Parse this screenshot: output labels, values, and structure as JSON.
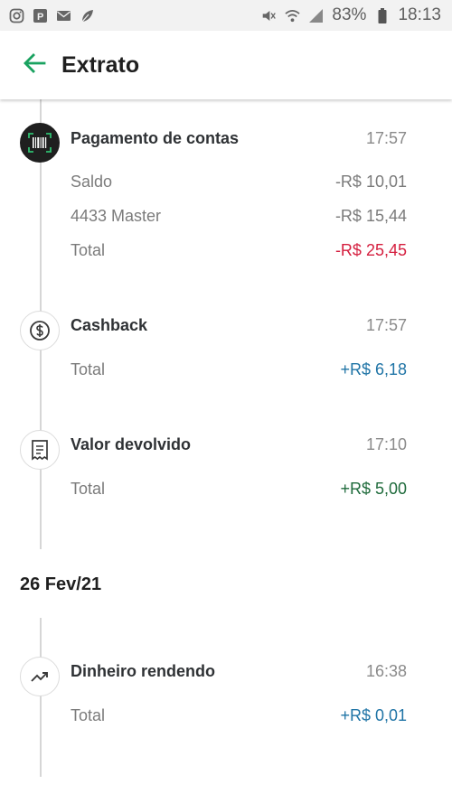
{
  "status_bar": {
    "battery": "83%",
    "time": "18:13",
    "left_icons": [
      "instagram-icon",
      "parking-icon",
      "mail-icon",
      "leaf-icon"
    ],
    "right_icons": [
      "mute-icon",
      "wifi-icon",
      "signal-icon",
      "battery-icon"
    ]
  },
  "app_bar": {
    "title": "Extrato",
    "back_icon": "arrow-left-icon",
    "accent": "#1aa260"
  },
  "timeline": [
    {
      "icon": "barcode-icon",
      "title": "Pagamento de contas",
      "time": "17:57",
      "rows": [
        {
          "label": "Saldo",
          "value": "-R$ 10,01",
          "color": "#7b7b7b"
        },
        {
          "label": "4433 Master",
          "value": "-R$ 15,44",
          "color": "#7b7b7b"
        },
        {
          "label": "Total",
          "value": "-R$ 25,45",
          "color": "#d51f3f"
        }
      ]
    },
    {
      "icon": "dollar-coin-icon",
      "title": "Cashback",
      "time": "17:57",
      "rows": [
        {
          "label": "Total",
          "value": "+R$ 6,18",
          "color": "#1f74a6"
        }
      ]
    },
    {
      "icon": "receipt-icon",
      "title": "Valor devolvido",
      "time": "17:10",
      "rows": [
        {
          "label": "Total",
          "value": "+R$ 5,00",
          "color": "#1f6b3c"
        }
      ]
    }
  ],
  "date_heading": "26 Fev/21",
  "timeline_2": [
    {
      "icon": "trending-up-icon",
      "title": "Dinheiro rendendo",
      "time": "16:38",
      "rows": [
        {
          "label": "Total",
          "value": "+R$ 0,01",
          "color": "#1f74a6"
        }
      ]
    }
  ]
}
